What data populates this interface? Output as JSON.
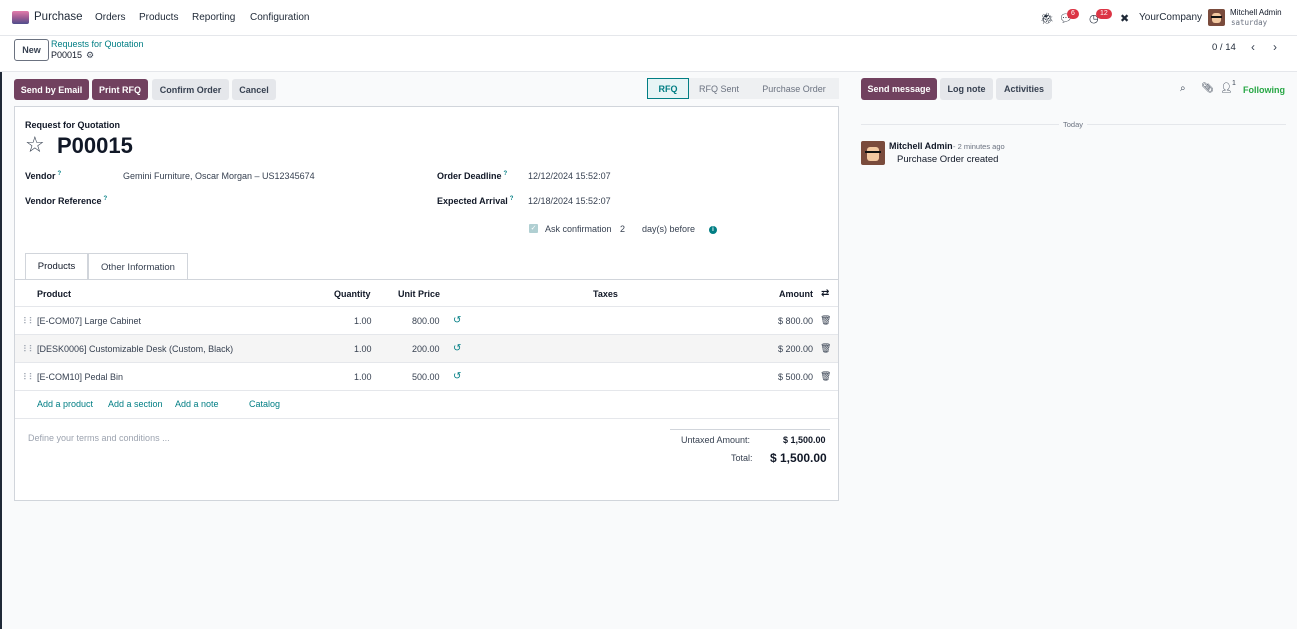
{
  "topbar": {
    "app_name": "Purchase",
    "menus": [
      "Orders",
      "Products",
      "Reporting",
      "Configuration"
    ],
    "messages_count": "6",
    "activities_count": "12",
    "company": "YourCompany",
    "user_name": "Mitchell Admin",
    "user_db": "saturday"
  },
  "control_panel": {
    "new_label": "New",
    "breadcrumb_parent": "Requests for Quotation",
    "breadcrumb_current": "P00015",
    "pager": "0 / 14"
  },
  "actions": {
    "send_email": "Send by Email",
    "print_rfq": "Print RFQ",
    "confirm_order": "Confirm Order",
    "cancel": "Cancel"
  },
  "status_stages": [
    "RFQ",
    "RFQ Sent",
    "Purchase Order"
  ],
  "form": {
    "record_type": "Request for Quotation",
    "name": "P00015",
    "vendor_label": "Vendor",
    "vendor_value": "Gemini Furniture, Oscar Morgan – US12345674",
    "vendor_ref_label": "Vendor Reference",
    "vendor_ref_value": "",
    "order_deadline_label": "Order Deadline",
    "order_deadline_value": "12/12/2024 15:52:07",
    "expected_arrival_label": "Expected Arrival",
    "expected_arrival_value": "12/18/2024 15:52:07",
    "ask_confirmation_label": "Ask confirmation",
    "ask_confirmation_days": "2",
    "days_before_label": "day(s) before",
    "help_mark": "?"
  },
  "tabs": [
    "Products",
    "Other Information"
  ],
  "table": {
    "headers": {
      "product": "Product",
      "quantity": "Quantity",
      "unit_price": "Unit Price",
      "taxes": "Taxes",
      "amount": "Amount"
    },
    "rows": [
      {
        "product": "[E-COM07] Large Cabinet",
        "quantity": "1.00",
        "unit_price": "800.00",
        "taxes": "",
        "amount": "$ 800.00"
      },
      {
        "product": "[DESK0006] Customizable Desk (Custom, Black)",
        "quantity": "1.00",
        "unit_price": "200.00",
        "taxes": "",
        "amount": "$ 200.00"
      },
      {
        "product": "[E-COM10] Pedal Bin",
        "quantity": "1.00",
        "unit_price": "500.00",
        "taxes": "",
        "amount": "$ 500.00"
      }
    ],
    "add_links": [
      "Add a product",
      "Add a section",
      "Add a note",
      "Catalog"
    ]
  },
  "footer": {
    "terms_placeholder": "Define your terms and conditions ...",
    "untaxed_label": "Untaxed Amount:",
    "untaxed_value": "$ 1,500.00",
    "total_label": "Total:",
    "total_value": "$ 1,500.00"
  },
  "chatter": {
    "send_message": "Send message",
    "log_note": "Log note",
    "activities": "Activities",
    "followers_count": "1",
    "following": "Following",
    "date_separator": "Today",
    "message_author": "Mitchell Admin",
    "message_time": "- 2 minutes ago",
    "message_body": "Purchase Order created"
  },
  "colors": {
    "primary": "#71415f",
    "link": "#017e84",
    "following": "#28a745",
    "badge": "#dc3545"
  }
}
